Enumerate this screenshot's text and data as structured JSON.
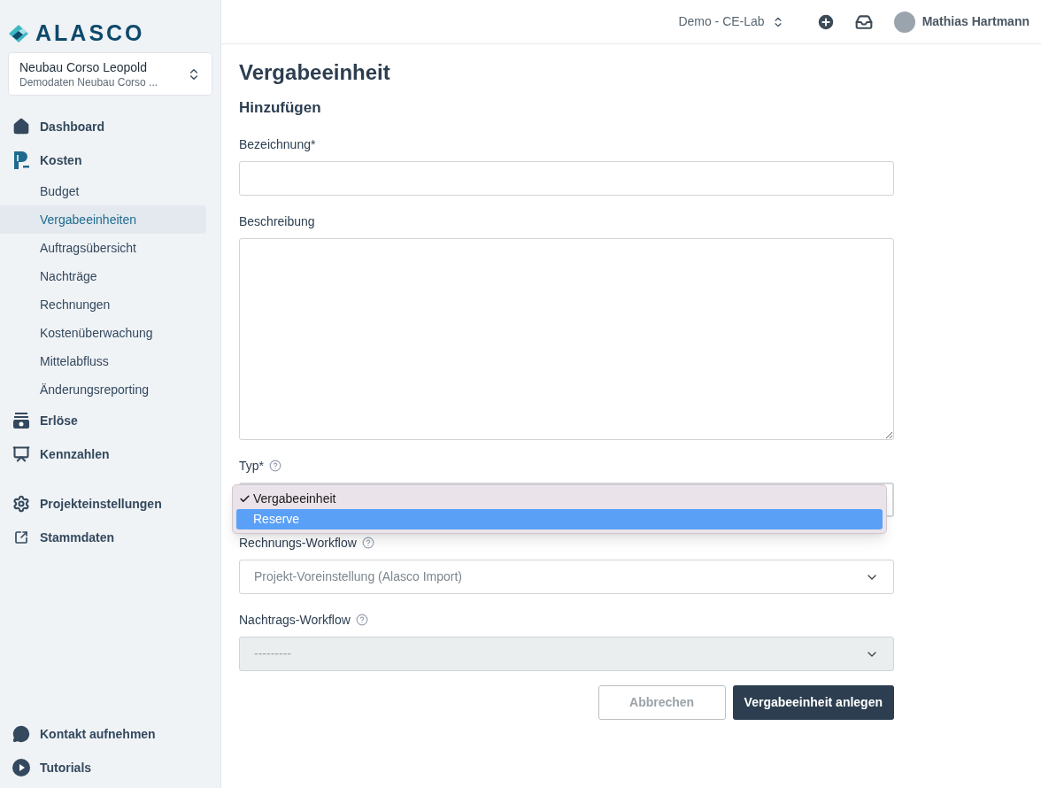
{
  "sidebar": {
    "logo": "ALASCO",
    "project": {
      "name": "Neubau Corso Leopold",
      "subtitle": "Demodaten Neubau Corso ..."
    },
    "items": [
      {
        "kind": "main",
        "label": "Dashboard",
        "selected": false
      },
      {
        "kind": "main",
        "label": "Kosten",
        "selected": false,
        "children": [
          {
            "label": "Budget",
            "selected": false
          },
          {
            "label": "Vergabeeinheiten",
            "selected": true
          },
          {
            "label": "Auftragsübersicht",
            "selected": false
          },
          {
            "label": "Nachträge",
            "selected": false
          },
          {
            "label": "Rechnungen",
            "selected": false
          },
          {
            "label": "Kostenüberwachung",
            "selected": false
          },
          {
            "label": "Mittelabfluss",
            "selected": false
          },
          {
            "label": "Änderungsreporting",
            "selected": false
          }
        ]
      },
      {
        "kind": "main",
        "label": "Erlöse",
        "selected": false
      },
      {
        "kind": "main",
        "label": "Kennzahlen",
        "selected": false
      },
      {
        "kind": "main",
        "label": "Projekteinstellungen",
        "selected": false
      },
      {
        "kind": "main",
        "label": "Stammdaten",
        "selected": false
      }
    ],
    "footer": [
      {
        "label": "Kontakt aufnehmen"
      },
      {
        "label": "Tutorials"
      }
    ]
  },
  "topbar": {
    "workspace": "Demo - CE-Lab",
    "user": "Mathias Hartmann"
  },
  "page": {
    "title": "Vergabeeinheit",
    "subtitle": "Hinzufügen",
    "fields": [
      {
        "kind": "text",
        "label": "Bezeichnung*",
        "help": false
      },
      {
        "kind": "textarea",
        "label": "Beschreibung",
        "help": false
      },
      {
        "kind": "select",
        "label": "Typ*",
        "help": true,
        "disabled": false,
        "expanded": true,
        "options": [
          {
            "label": "Vergabeeinheit",
            "checked": true,
            "selected": false
          },
          {
            "label": "Reserve",
            "checked": false,
            "selected": true
          }
        ]
      },
      {
        "kind": "select",
        "label": "Rechnungs-Workflow",
        "help": true,
        "disabled": false,
        "expanded": false,
        "value": "Projekt-Voreinstellung (Alasco Import)"
      },
      {
        "kind": "select",
        "label": "Nachtrags-Workflow",
        "help": true,
        "disabled": true,
        "expanded": false,
        "value": "---------"
      }
    ],
    "buttons": [
      {
        "kind": "secondary",
        "label": "Abbrechen"
      },
      {
        "kind": "primary",
        "label": "Vergabeeinheit anlegen"
      }
    ]
  }
}
